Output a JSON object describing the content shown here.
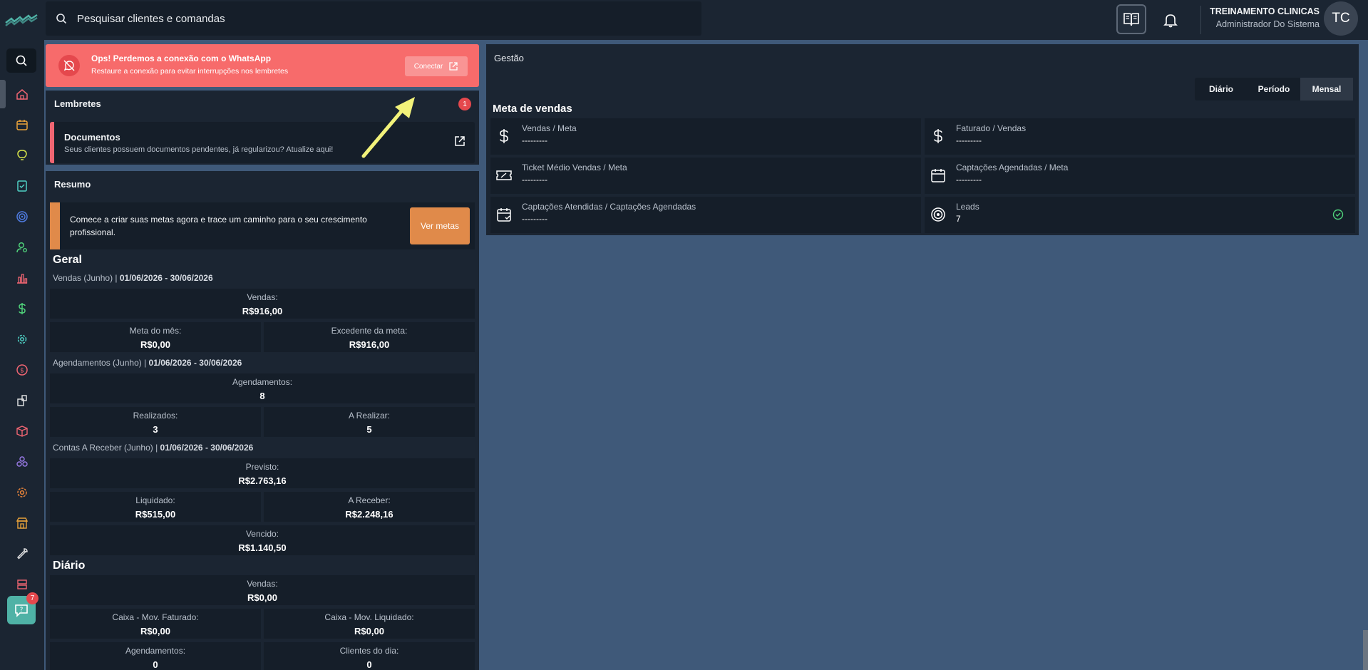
{
  "search": {
    "placeholder": "Pesquisar clientes e comandas"
  },
  "user": {
    "name": "TREINAMENTO CLINICAS",
    "role": "Administrador Do Sistema",
    "initials": "TC"
  },
  "icons": {
    "sidebar": [
      "search-icon",
      "home-icon",
      "calendar-icon",
      "lightbulb-icon",
      "checklist-icon",
      "target-icon",
      "user-search-icon",
      "chart-icon",
      "dollar-icon",
      "gear-icon",
      "coin-icon",
      "boxes-icon",
      "package-icon",
      "cubes-icon",
      "settings-icon",
      "store-icon",
      "wrench-icon",
      "server-icon",
      "export-icon"
    ],
    "colors": {
      "accent": "#4fb2a6",
      "alert": "#f76b6b",
      "warning": "#e08a4a",
      "danger": "#e5484d",
      "page_bg": "#3f5979",
      "panel_bg": "#1b2532"
    }
  },
  "help": {
    "badge": "7"
  },
  "alert": {
    "title": "Ops! Perdemos a conexão com o WhatsApp",
    "subtitle": "Restaure a conexão para evitar interrupções nos lembretes",
    "button": "Conectar"
  },
  "reminders": {
    "title": "Lembretes",
    "badge": "1",
    "item": {
      "title": "Documentos",
      "subtitle": "Seus clientes possuem documentos pendentes, já regularizou? Atualize aqui!"
    }
  },
  "summary": {
    "title": "Resumo",
    "goal": {
      "text": "Comece a criar suas metas agora e trace um caminho para o seu crescimento profissional.",
      "button": "Ver metas"
    },
    "geral": {
      "title": "Geral",
      "vendas_header": "Vendas (Junho) |",
      "vendas_range": "01/06/2026 - 30/06/2026",
      "vendas": {
        "label": "Vendas:",
        "value": "R$916,00"
      },
      "meta_mes": {
        "label": "Meta do mês:",
        "value": "R$0,00"
      },
      "excedente": {
        "label": "Excedente da meta:",
        "value": "R$916,00"
      },
      "agend_header": "Agendamentos (Junho) |",
      "agend_range": "01/06/2026 - 30/06/2026",
      "agendamentos": {
        "label": "Agendamentos:",
        "value": "8"
      },
      "realizados": {
        "label": "Realizados:",
        "value": "3"
      },
      "a_realizar": {
        "label": "A Realizar:",
        "value": "5"
      },
      "contas_header": "Contas A Receber (Junho) |",
      "contas_range": "01/06/2026 - 30/06/2026",
      "previsto": {
        "label": "Previsto:",
        "value": "R$2.763,16"
      },
      "liquidado": {
        "label": "Liquidado:",
        "value": "R$515,00"
      },
      "a_receber": {
        "label": "A Receber:",
        "value": "R$2.248,16"
      },
      "vencido": {
        "label": "Vencido:",
        "value": "R$1.140,50"
      }
    },
    "diario": {
      "title": "Diário",
      "vendas": {
        "label": "Vendas:",
        "value": "R$0,00"
      },
      "caixa_fat": {
        "label": "Caixa - Mov. Faturado:",
        "value": "R$0,00"
      },
      "caixa_liq": {
        "label": "Caixa - Mov. Liquidado:",
        "value": "R$0,00"
      },
      "agendamentos": {
        "label": "Agendamentos:",
        "value": "0"
      },
      "clientes": {
        "label": "Clientes do dia:",
        "value": "0"
      }
    }
  },
  "gestao": {
    "title": "Gestão",
    "tabs": [
      "Diário",
      "Período",
      "Mensal"
    ],
    "meta_title": "Meta de vendas",
    "kpis": [
      {
        "label": "Vendas / Meta",
        "value": "---------",
        "icon": "dollar-icon"
      },
      {
        "label": "Faturado / Vendas",
        "value": "---------",
        "icon": "dollar-icon"
      },
      {
        "label": "Ticket Médio Vendas / Meta",
        "value": "---------",
        "icon": "ticket-icon"
      },
      {
        "label": "Captações Agendadas / Meta",
        "value": "---------",
        "icon": "calendar-icon"
      },
      {
        "label": "Captações Atendidas / Captações Agendadas",
        "value": "---------",
        "icon": "calendar-check-icon"
      },
      {
        "label": "Leads",
        "value": "7",
        "icon": "target-icon"
      }
    ]
  }
}
